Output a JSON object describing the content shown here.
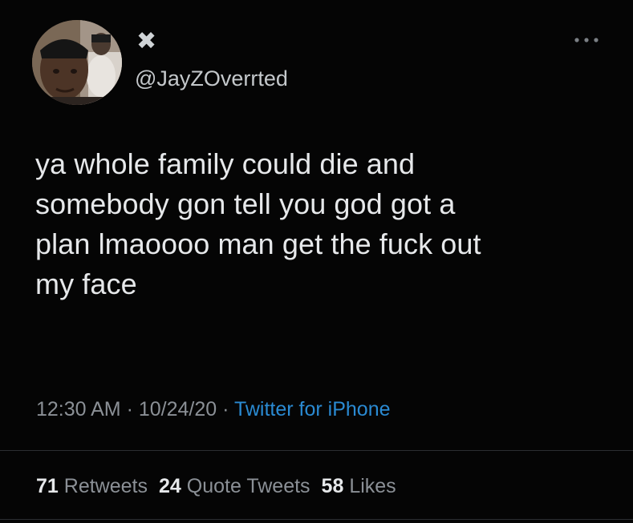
{
  "tweet": {
    "display_name": "✖",
    "handle": "@JayZOverrted",
    "text": "ya whole family could die and\nsomebody gon tell you god got a\nplan lmaoooo man get the fuck out\nmy face",
    "time": "12:30 AM",
    "date": "10/24/20",
    "separator": "·",
    "source": "Twitter for iPhone",
    "stats": {
      "retweets_count": "71",
      "retweets_label": "Retweets",
      "quotes_count": "24",
      "quotes_label": "Quote Tweets",
      "likes_count": "58",
      "likes_label": "Likes"
    }
  },
  "icons": {
    "avatar": "avatar-photo",
    "more": "more-options-icon"
  },
  "colors": {
    "background": "#050505",
    "text": "#e6e8ea",
    "secondary": "#8b9096",
    "link": "#2a8ad2"
  }
}
